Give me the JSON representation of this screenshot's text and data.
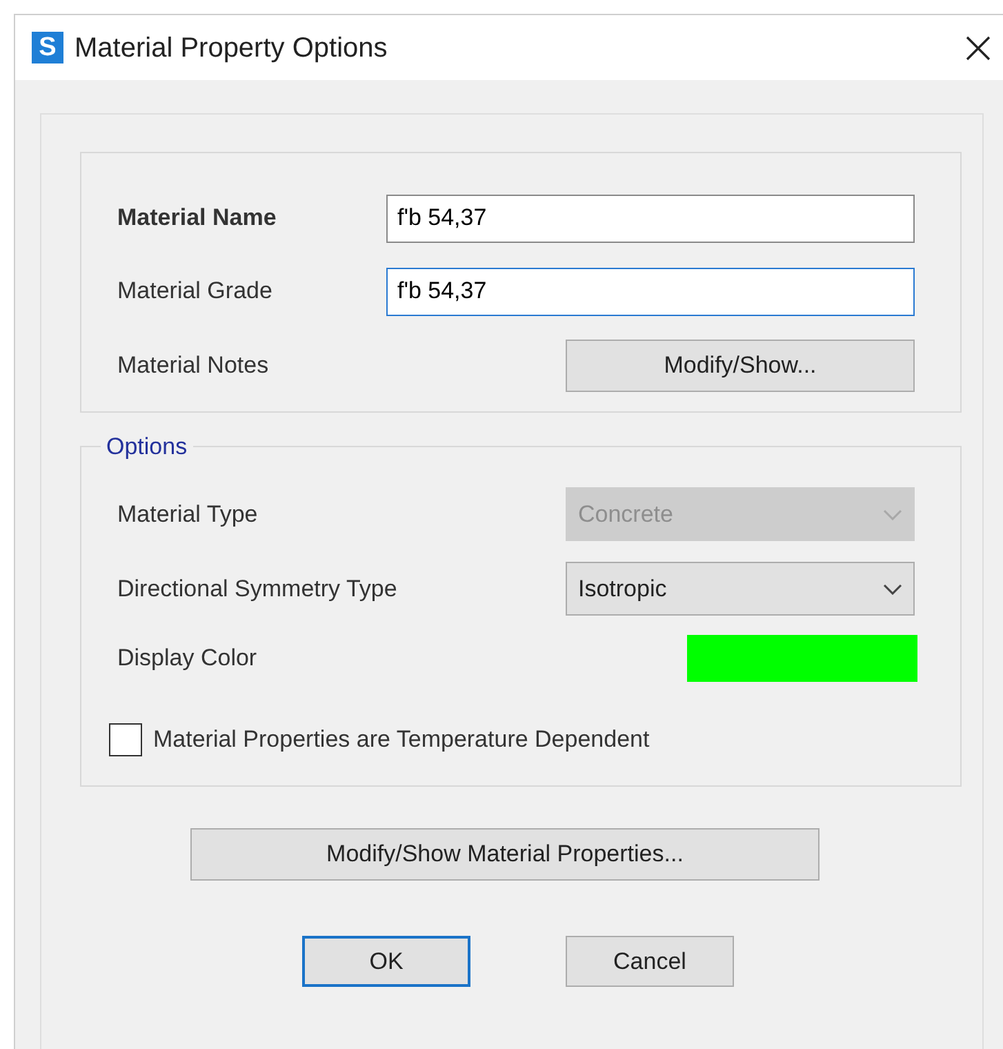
{
  "window": {
    "title": "Material Property Options",
    "icon_letter": "S"
  },
  "material_name": {
    "label": "Material Name",
    "value": "f'b 54,37",
    "focused": false
  },
  "material_grade": {
    "label": "Material Grade",
    "value": "f'b 54,37",
    "focused": true
  },
  "material_notes": {
    "label": "Material Notes",
    "button": "Modify/Show..."
  },
  "options": {
    "title": "Options",
    "material_type": {
      "label": "Material Type",
      "value": "Concrete",
      "disabled": true
    },
    "symmetry_type": {
      "label": "Directional Symmetry Type",
      "value": "Isotropic",
      "disabled": false
    },
    "display_color": {
      "label": "Display Color",
      "color": "#00ff00"
    },
    "temperature_dependent": {
      "label": "Material Properties are Temperature Dependent",
      "checked": false
    }
  },
  "properties_button": "Modify/Show Material Properties...",
  "buttons": [
    {
      "label": "OK",
      "default": true
    },
    {
      "label": "Cancel",
      "default": false
    }
  ]
}
